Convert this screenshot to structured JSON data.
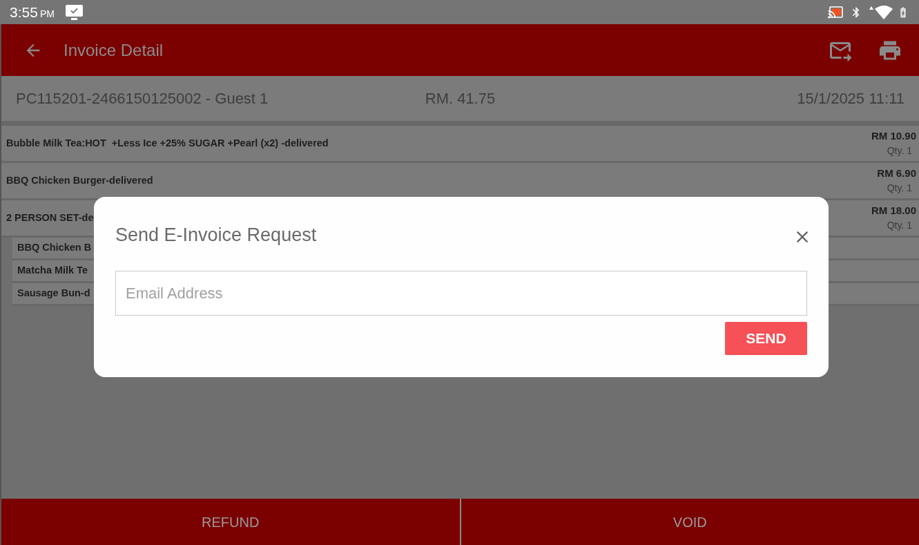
{
  "status_bar": {
    "time": "3:55",
    "meridiem": "PM"
  },
  "app_bar": {
    "title": "Invoice Detail"
  },
  "invoice_header": {
    "invoice_id": "PC115201-2466150125002 - Guest 1",
    "total": "RM. 41.75",
    "datetime": "15/1/2025 11:11"
  },
  "items": [
    {
      "name": "Bubble Milk Tea:HOT  +Less Ice +25% SUGAR +Pearl (x2) -delivered",
      "price": "RM 10.90",
      "qty": "Qty. 1"
    },
    {
      "name": "BBQ Chicken Burger-delivered",
      "price": "RM 6.90",
      "qty": "Qty. 1"
    },
    {
      "name": "2 PERSON SET-de",
      "price": "RM 18.00",
      "qty": "Qty. 1",
      "children": [
        {
          "name": "BBQ Chicken B"
        },
        {
          "name": "Matcha Milk Te"
        },
        {
          "name": "Sausage Bun-d"
        }
      ]
    }
  ],
  "footer_buttons": [
    {
      "label": "REFUND"
    },
    {
      "label": "VOID"
    }
  ],
  "dialog": {
    "title": "Send E-Invoice Request",
    "email_field": {
      "placeholder": "Email Address"
    },
    "send_button": "SEND"
  }
}
